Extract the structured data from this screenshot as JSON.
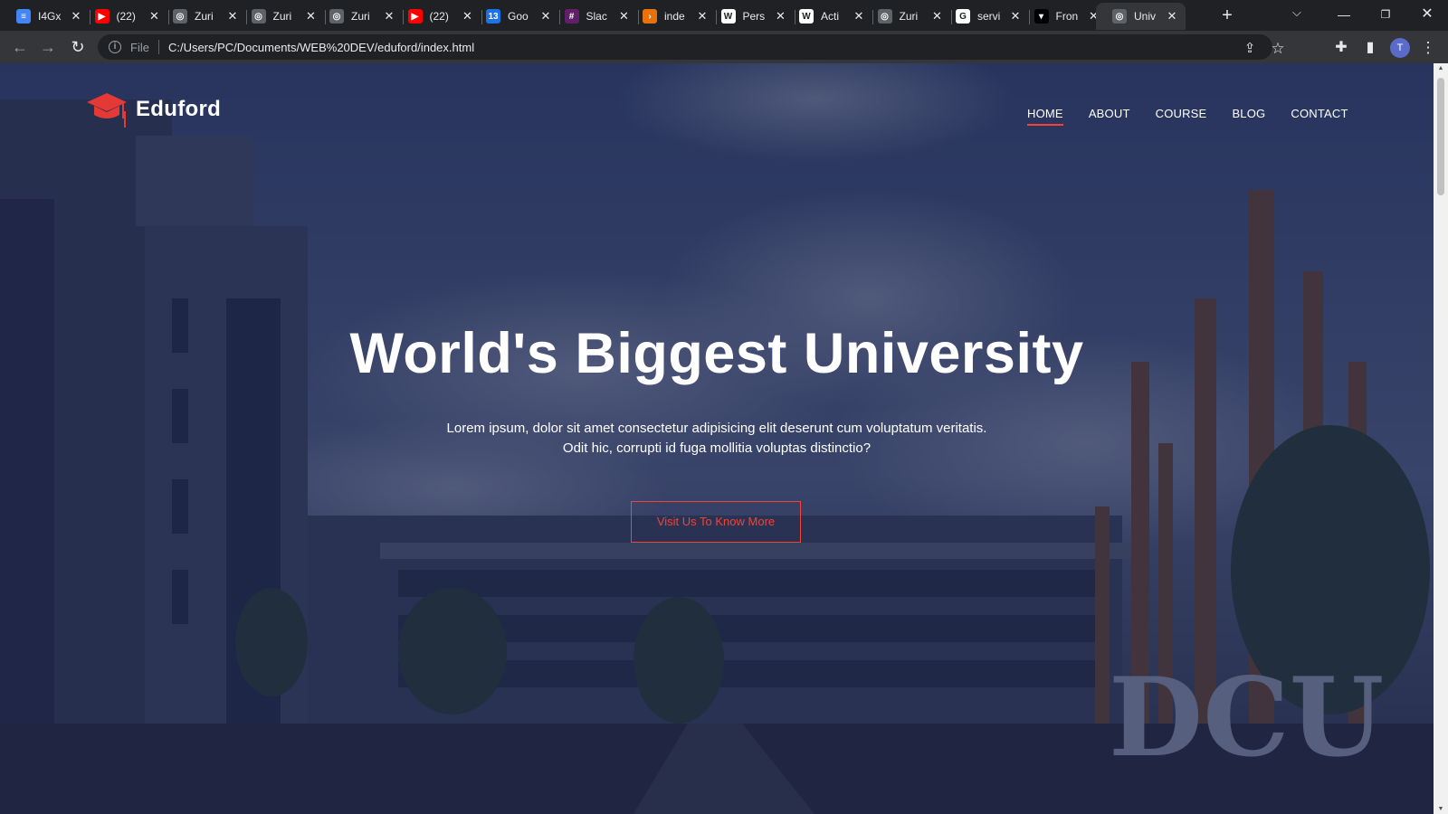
{
  "browser": {
    "tabs": [
      {
        "title": "I4Gx",
        "favicon": "doc-icon",
        "color": "#4285f4",
        "glyph": "≡"
      },
      {
        "title": "(22)",
        "favicon": "youtube-icon",
        "color": "#ff0000",
        "glyph": "▶"
      },
      {
        "title": "Zuri",
        "favicon": "globe-icon",
        "color": "#5f6368",
        "glyph": "◎"
      },
      {
        "title": "Zuri",
        "favicon": "globe-icon",
        "color": "#5f6368",
        "glyph": "◎"
      },
      {
        "title": "Zuri",
        "favicon": "globe-icon",
        "color": "#5f6368",
        "glyph": "◎"
      },
      {
        "title": "(22)",
        "favicon": "youtube-icon",
        "color": "#ff0000",
        "glyph": "▶"
      },
      {
        "title": "Goo",
        "favicon": "calendar-icon",
        "color": "#1a73e8",
        "glyph": "13"
      },
      {
        "title": "Slac",
        "favicon": "slack-icon",
        "color": "#611f69",
        "glyph": "#"
      },
      {
        "title": "inde",
        "favicon": "code-icon",
        "color": "#e8710a",
        "glyph": "›"
      },
      {
        "title": "Pers",
        "favicon": "wix-icon",
        "color": "#ffffff",
        "glyph": "W"
      },
      {
        "title": "Acti",
        "favicon": "wix-icon",
        "color": "#ffffff",
        "glyph": "W"
      },
      {
        "title": "Zuri",
        "favicon": "globe-icon",
        "color": "#5f6368",
        "glyph": "◎"
      },
      {
        "title": "servi",
        "favicon": "google-icon",
        "color": "#ffffff",
        "glyph": "G"
      },
      {
        "title": "Fron",
        "favicon": "vercel-icon",
        "color": "#000000",
        "glyph": "▾"
      },
      {
        "title": "Univ",
        "favicon": "globe-icon",
        "color": "#5f6368",
        "glyph": "◎",
        "active": true
      }
    ],
    "address": {
      "scheme_label": "File",
      "url": "C:/Users/PC/Documents/WEB%20DEV/eduford/index.html"
    },
    "profile_initial": "T"
  },
  "page": {
    "logo_text": "Eduford",
    "nav": [
      {
        "label": "HOME",
        "active": true
      },
      {
        "label": "ABOUT",
        "active": false
      },
      {
        "label": "COURSE",
        "active": false
      },
      {
        "label": "BLOG",
        "active": false
      },
      {
        "label": "CONTACT",
        "active": false
      }
    ],
    "hero": {
      "title": "World's Biggest University",
      "text_line1": "Lorem ipsum, dolor sit amet consectetur adipisicing elit deserunt cum voluptatum veritatis.",
      "text_line2": "Odit hic, corrupti id fuga mollitia voluptas distinctio?",
      "button_label": "Visit Us To Know More"
    },
    "background_letters": "DCU",
    "accent_color": "#f44336"
  }
}
